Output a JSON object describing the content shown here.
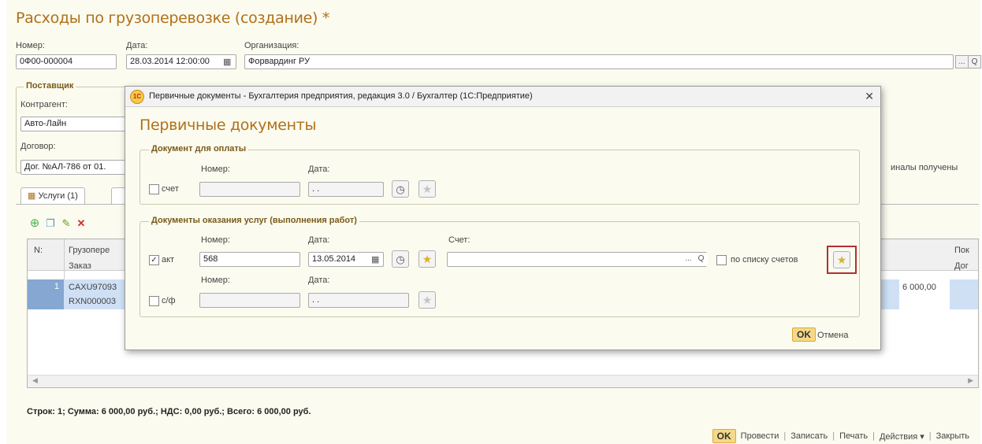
{
  "form": {
    "title": "Расходы по грузоперевозке (создание) *",
    "number_label": "Номер:",
    "number_value": "0Ф00-000004",
    "date_label": "Дата:",
    "date_value": "28.03.2014 12:00:00",
    "org_label": "Организация:",
    "org_value": "Форвардинг РУ",
    "supplier_group": "Поставщик",
    "contractor_label": "Контрагент:",
    "contractor_value": "Авто-Лайн",
    "contract_label": "Договор:",
    "contract_value": "Дог. №АЛ-786 от 01.",
    "originals_text": "иналы получены",
    "tabs": [
      {
        "label": "Услуги (1)"
      }
    ],
    "grid": {
      "col_n": "N:",
      "col_cargo": "Грузопере",
      "col_order": "Заказ",
      "col_pok": "Пок",
      "col_dog": "Дог",
      "row_num": "1",
      "row_cargo": "CAXU97093",
      "row_order": "RXN000003",
      "row_amount": "6 000,00"
    },
    "summary": "Строк: 1;  Сумма: 6 000,00 руб.;  НДС: 0,00 руб.;  Всего: 6 000,00 руб.",
    "bottom_buttons": {
      "ok": "OK",
      "post": "Провести",
      "save": "Записать",
      "print": "Печать",
      "actions": "Действия ▾",
      "close": "Закрыть"
    }
  },
  "dialog": {
    "window_title": "Первичные документы - Бухгалтерия предприятия, редакция 3.0 / Бухгалтер  (1С:Предприятие)",
    "logo_text": "1С",
    "heading": "Первичные документы",
    "payment_group": "Документ для оплаты",
    "number_label": "Номер:",
    "date_label": "Дата:",
    "invoice_checkbox_label": "счет",
    "invoice_number": "",
    "invoice_date": " . .",
    "services_group": "Документы оказания услуг (выполнения работ)",
    "act_checkbox_label": "акт",
    "act_number": "568",
    "act_date": "13.05.2014",
    "account_label": "Счет:",
    "account_value": "",
    "by_list_label": "по списку счетов",
    "sf_checkbox_label": "с/ф",
    "sf_number": "",
    "sf_date": " . .",
    "ok_label": "OK",
    "cancel_label": "Отмена",
    "checkmark": "✓",
    "close_glyph": "✕"
  },
  "icons": {
    "calendar": "calendar-icon",
    "ellipsis": "...",
    "search": "Q"
  },
  "colors": {
    "title": "#b0701a",
    "selection": "#85a7d1",
    "ok_button": "#f5d888",
    "highlight": "#b33030"
  }
}
